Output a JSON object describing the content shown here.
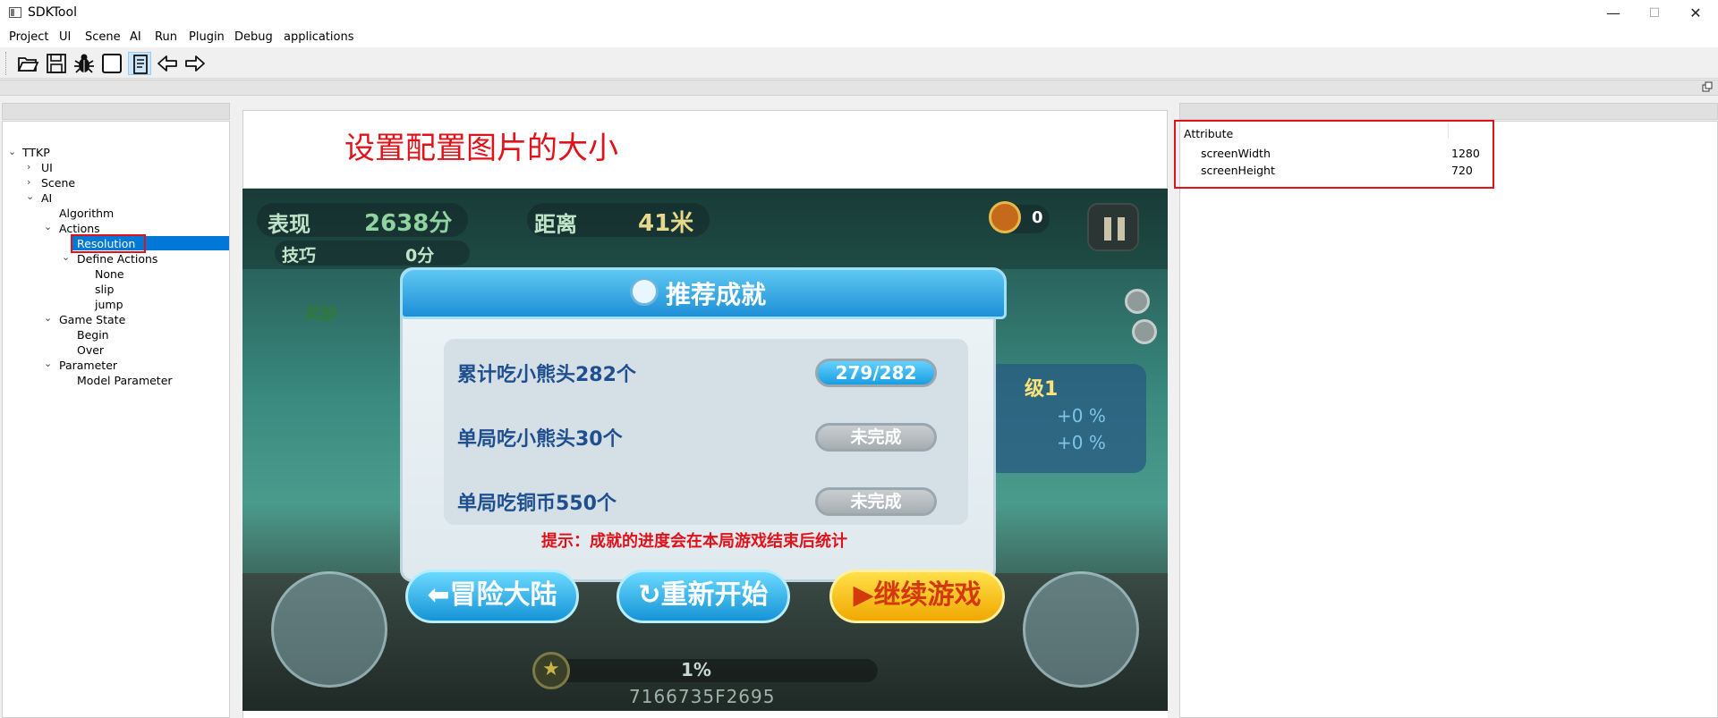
{
  "window": {
    "title": "SDKTool",
    "minimize": "—",
    "maximize": "☐",
    "close": "✕"
  },
  "menu": [
    "Project",
    "UI",
    "Scene",
    "AI",
    "Run",
    "Plugin",
    "Debug",
    "applications"
  ],
  "toolbar": {
    "icons": [
      "open-folder-icon",
      "save-icon",
      "debug-bug-icon",
      "blank-square-icon",
      "label-tool-icon",
      "back-arrow-icon",
      "forward-arrow-icon"
    ]
  },
  "tree": {
    "root": "TTKP",
    "ui": "UI",
    "scene": "Scene",
    "ai": "AI",
    "algorithm": "Algorithm",
    "actions": "Actions",
    "resolution": "Resolution",
    "define_actions": "Define Actions",
    "none": "None",
    "slip": "slip",
    "jump": "jump",
    "game_state": "Game State",
    "begin": "Begin",
    "over": "Over",
    "parameter": "Parameter",
    "model_parameter": "Model Parameter"
  },
  "caption": "设置配置图片的大小",
  "game": {
    "score_label": "表现",
    "score_value": "2638分",
    "distance_label": "距离",
    "distance_value": "41米",
    "skill_label": "技巧",
    "skill_value": "0分",
    "gem_count": "0",
    "reward_label": "奖励",
    "panel_title": "推荐成就",
    "achievements": [
      {
        "text": "累计吃小熊头282个",
        "status": "279/282"
      },
      {
        "text": "单局吃小熊头30个",
        "status": "未完成"
      },
      {
        "text": "单局吃铜币550个",
        "status": "未完成"
      }
    ],
    "hint": "提示：成就的进度会在本局游戏结束后统计",
    "btn_adventure": "冒险大陆",
    "btn_restart": "重新开始",
    "btn_continue": "继续游戏",
    "progress_percent": "1%",
    "code": "7166735F2695",
    "side_level": "级1",
    "side_bonus1": "+0 %",
    "side_bonus2": "+0 %"
  },
  "attributes": {
    "header": "Attribute",
    "rows": [
      {
        "name": "screenWidth",
        "value": "1280"
      },
      {
        "name": "screenHeight",
        "value": "720"
      }
    ]
  },
  "colors": {
    "accent_red": "#e0121a",
    "selection": "#0078d7"
  }
}
